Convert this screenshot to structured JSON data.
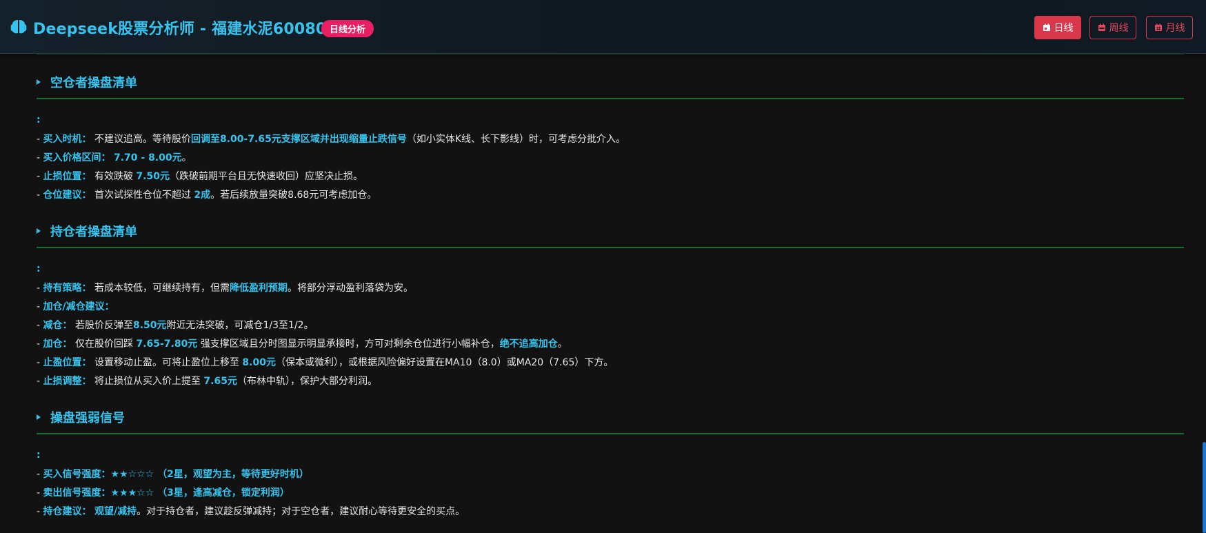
{
  "header": {
    "title": "Deepseek股票分析师 - 福建水泥600802",
    "badge": "日线分析",
    "buttons": {
      "day": "日线",
      "week": "周线",
      "month": "月线"
    },
    "active_button": "day",
    "accent_color": "#36c3ee",
    "badge_color": "#e91e63",
    "button_color": "#d9384a"
  },
  "sections": [
    {
      "title": "空仓者操盘清单",
      "colon": ":",
      "lines": [
        [
          "- ",
          "买入时机：",
          " 不建议追高。等待股价",
          "回调至8.00-7.65元支撑区域并出现缩量止跌信号",
          "（如小实体K线、长下影线）时，可考虑分批介入。"
        ],
        [
          "- ",
          "买入价格区间：",
          " ",
          "7.70 - 8.00元",
          "。"
        ],
        [
          "- ",
          "止损位置：",
          " 有效跌破 ",
          "7.50元",
          "（跌破前期平台且无快速收回）应坚决止损。"
        ],
        [
          "- ",
          "仓位建议：",
          " 首次试探性仓位不超过 ",
          "2成",
          "。若后续放量突破8.68元可考虑加仓。"
        ]
      ]
    },
    {
      "title": "持仓者操盘清单",
      "colon": ":",
      "lines": [
        [
          "- ",
          "持有策略：",
          " 若成本较低，可继续持有，但需",
          "降低盈利预期",
          "。将部分浮动盈利落袋为安。"
        ],
        [
          "- ",
          "加仓/减仓建议：",
          "",
          "",
          ""
        ],
        [
          "- ",
          "减仓：",
          " 若股价反弹至",
          "8.50元",
          "附近无法突破，可减仓1/3至1/2。"
        ],
        [
          "- ",
          "加仓：",
          " 仅在股价回踩 ",
          "7.65-7.80元",
          " 强支撑区域且分时图显示明显承接时，方可对剩余仓位进行小幅补仓，",
          "绝不追高加仓",
          "。"
        ],
        [
          "- ",
          "止盈位置：",
          " 设置移动止盈。可将止盈位上移至 ",
          "8.00元",
          "（保本或微利），或根据风险偏好设置在MA10（8.0）或MA20（7.65）下方。"
        ],
        [
          "- ",
          "止损调整：",
          " 将止损位从买入价上提至 ",
          "7.65元",
          "（布林中轨），保护大部分利润。"
        ]
      ]
    },
    {
      "title": "操盘强弱信号",
      "colon": ":",
      "lines": [
        [
          "- ",
          "买入信号强度：★★☆☆☆ （2星，观望为主，等待更好时机）",
          "",
          "",
          ""
        ],
        [
          "- ",
          "卖出信号强度：★★★☆☆ （3星，逢高减仓，锁定利润）",
          "",
          "",
          ""
        ],
        [
          "- ",
          "持仓建议：",
          " ",
          "观望/减持",
          "。对于持仓者，建议趁反弹减持；对于空仓者，建议耐心等待更安全的买点。"
        ]
      ]
    }
  ]
}
